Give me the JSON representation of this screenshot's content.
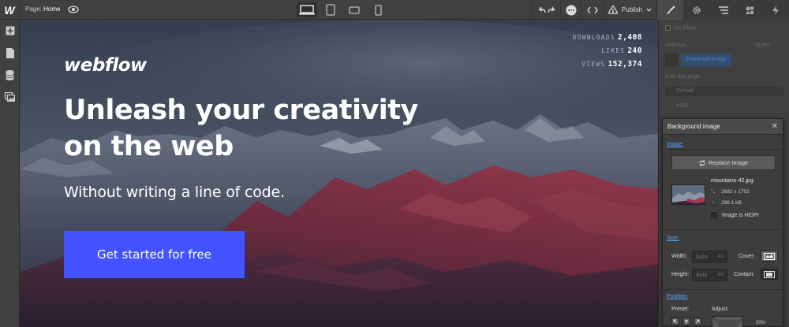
{
  "app": {
    "logo": "W"
  },
  "topbar": {
    "page_prefix": "Page:",
    "page_name": "Home",
    "publish_label": "Publish"
  },
  "canvas": {
    "stats": [
      {
        "label": "DOWNLOADS",
        "value": "2,408"
      },
      {
        "label": "LIKES",
        "value": "240"
      },
      {
        "label": "VIEWS",
        "value": "152,374"
      }
    ],
    "brand": "webflow",
    "headline_line1": "Unleash your creativity",
    "headline_line2": "on the web",
    "subheadline": "Without writing a line of code.",
    "cta_label": "Get started for free"
  },
  "right_panel": {
    "bg_label": "Div Block",
    "selector_label": "Selector",
    "selector_value": "thumbnail-image",
    "styles_label": "Styles",
    "on_page_text": "1 on this page",
    "font_hint": "Default",
    "color_hex": "#333"
  },
  "bg_image_popup": {
    "title": "Background image",
    "image_section": "Image:",
    "replace_button": "Replace Image",
    "file_name": "mountains-42.jpg",
    "dimensions": "2682 x 1702",
    "file_size": "296.1 kB",
    "hidpi_label": "Image is HiDPI",
    "size_section": "Size:",
    "width_label": "Width:",
    "height_label": "Height:",
    "width_value": "Auto",
    "height_value": "Auto",
    "unit": "PX",
    "cover_label": "Cover:",
    "contain_label": "Contain:",
    "position_section": "Position:",
    "preset_label": "Preset:",
    "adjust_label": "Adjust:",
    "adjust_value": "50%"
  }
}
